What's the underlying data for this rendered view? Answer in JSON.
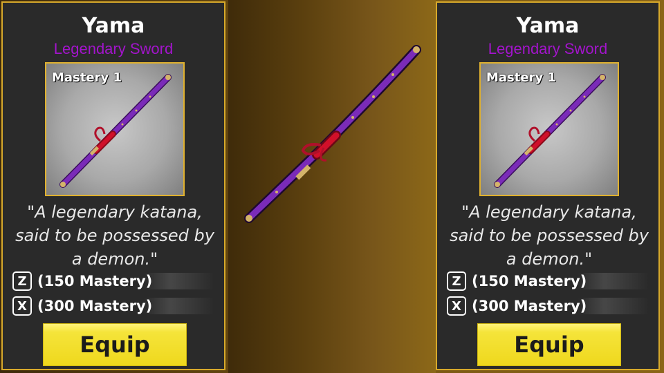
{
  "panels": [
    {
      "title": "Yama",
      "subtitle": "Legendary Sword",
      "mastery_label": "Mastery 1",
      "description": "\"A legendary katana, said to be possessed by a demon.\"",
      "skills": [
        {
          "key": "Z",
          "text": "(150 Mastery)"
        },
        {
          "key": "X",
          "text": "(300 Mastery)"
        }
      ],
      "equip_label": "Equip"
    },
    {
      "title": "Yama",
      "subtitle": "Legendary Sword",
      "mastery_label": "Mastery 1",
      "description": "\"A legendary katana, said to be possessed by a demon.\"",
      "skills": [
        {
          "key": "Z",
          "text": "(150 Mastery)"
        },
        {
          "key": "X",
          "text": "(300 Mastery)"
        }
      ],
      "equip_label": "Equip"
    }
  ],
  "colors": {
    "panel_bg": "#2a2a2a",
    "panel_border": "#d7a92b",
    "subtitle": "#a314cc",
    "equip_button": "#efd81d",
    "sheath": "#7a2bb8",
    "wrap": "#c8102e"
  },
  "icons": {
    "sword": "katana-sword-icon"
  }
}
